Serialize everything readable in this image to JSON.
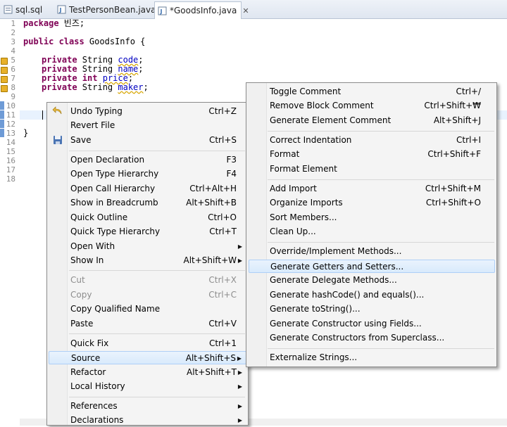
{
  "tabs": [
    {
      "label": "sql.sql",
      "icon": "sql-file-icon",
      "active": false
    },
    {
      "label": "TestPersonBean.java",
      "icon": "java-file-icon",
      "active": false
    },
    {
      "label": "*GoodsInfo.java",
      "icon": "java-file-icon",
      "active": true,
      "close": "✕"
    }
  ],
  "editor": {
    "line_numbers": [
      "1",
      "2",
      "3",
      "4",
      "5",
      "6",
      "7",
      "8",
      "9",
      "10",
      "11",
      "12",
      "13",
      "14",
      "15",
      "16",
      "17",
      "18"
    ],
    "line1_kw": "package",
    "line1_rest": " 빈즈;",
    "line3_kw": "public class",
    "line3_rest": " GoodsInfo {",
    "fields": [
      {
        "mod": "private",
        "type": " String ",
        "name": "code"
      },
      {
        "mod": "private",
        "type": " String ",
        "name": "name"
      },
      {
        "mod": "private int",
        "type": " ",
        "name": "price"
      },
      {
        "mod": "private",
        "type": " String ",
        "name": "maker"
      }
    ],
    "closing_brace": "}"
  },
  "context_menu": {
    "undo": {
      "label": "Undo Typing",
      "shortcut": "Ctrl+Z"
    },
    "revert": {
      "label": "Revert File"
    },
    "save": {
      "label": "Save",
      "shortcut": "Ctrl+S"
    },
    "open_declaration": {
      "label": "Open Declaration",
      "shortcut": "F3"
    },
    "open_type_hierarchy": {
      "label": "Open Type Hierarchy",
      "shortcut": "F4"
    },
    "open_call_hierarchy": {
      "label": "Open Call Hierarchy",
      "shortcut": "Ctrl+Alt+H"
    },
    "show_breadcrumb": {
      "label": "Show in Breadcrumb",
      "shortcut": "Alt+Shift+B"
    },
    "quick_outline": {
      "label": "Quick Outline",
      "shortcut": "Ctrl+O"
    },
    "quick_type_hierarchy": {
      "label": "Quick Type Hierarchy",
      "shortcut": "Ctrl+T"
    },
    "open_with": {
      "label": "Open With"
    },
    "show_in": {
      "label": "Show In",
      "shortcut": "Alt+Shift+W"
    },
    "cut": {
      "label": "Cut",
      "shortcut": "Ctrl+X"
    },
    "copy": {
      "label": "Copy",
      "shortcut": "Ctrl+C"
    },
    "copy_qualified": {
      "label": "Copy Qualified Name"
    },
    "paste": {
      "label": "Paste",
      "shortcut": "Ctrl+V"
    },
    "quick_fix": {
      "label": "Quick Fix",
      "shortcut": "Ctrl+1"
    },
    "source": {
      "label": "Source",
      "shortcut": "Alt+Shift+S"
    },
    "refactor": {
      "label": "Refactor",
      "shortcut": "Alt+Shift+T"
    },
    "local_history": {
      "label": "Local History"
    },
    "references": {
      "label": "References"
    },
    "declarations": {
      "label": "Declarations"
    },
    "submenu_arrow": "▶"
  },
  "source_menu": {
    "toggle_comment": {
      "label": "Toggle Comment",
      "shortcut": "Ctrl+/"
    },
    "remove_block_comment": {
      "label": "Remove Block Comment",
      "shortcut": "Ctrl+Shift+₩"
    },
    "generate_element_comment": {
      "label": "Generate Element Comment",
      "shortcut": "Alt+Shift+J"
    },
    "correct_indentation": {
      "label": "Correct Indentation",
      "shortcut": "Ctrl+I"
    },
    "format": {
      "label": "Format",
      "shortcut": "Ctrl+Shift+F"
    },
    "format_element": {
      "label": "Format Element"
    },
    "add_import": {
      "label": "Add Import",
      "shortcut": "Ctrl+Shift+M"
    },
    "organize_imports": {
      "label": "Organize Imports",
      "shortcut": "Ctrl+Shift+O"
    },
    "sort_members": {
      "label": "Sort Members..."
    },
    "clean_up": {
      "label": "Clean Up..."
    },
    "override_implement": {
      "label": "Override/Implement Methods..."
    },
    "getters_setters": {
      "label": "Generate Getters and Setters..."
    },
    "delegate_methods": {
      "label": "Generate Delegate Methods..."
    },
    "hashcode_equals": {
      "label": "Generate hashCode() and equals()..."
    },
    "to_string": {
      "label": "Generate toString()..."
    },
    "constructor_fields": {
      "label": "Generate Constructor using Fields..."
    },
    "constructors_superclass": {
      "label": "Generate Constructors from Superclass..."
    },
    "externalize_strings": {
      "label": "Externalize Strings..."
    }
  },
  "colors": {
    "keyword": "#7f0055",
    "field": "#0000c0",
    "highlight": "#d9eafc",
    "line_number": "#8a8a8a"
  }
}
